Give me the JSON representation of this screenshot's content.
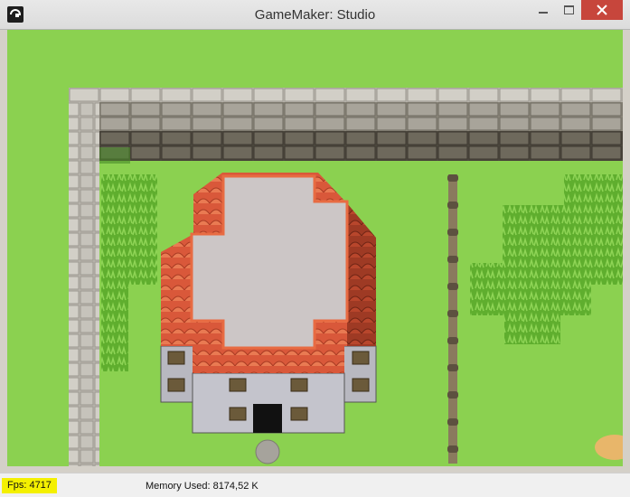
{
  "window": {
    "title": "GameMaker: Studio",
    "icon": "gamemaker-icon"
  },
  "controls": {
    "minimize": "minimize-icon",
    "maximize": "maximize-icon",
    "close": "close-icon"
  },
  "scene": {
    "description_icons": [
      "stone-wall",
      "house-red-roof",
      "hedge",
      "wooden-fence",
      "bush",
      "stepping-stone",
      "sand-patch"
    ]
  },
  "status": {
    "fps_label": "Fps: 4717",
    "memory_label": "Memory Used: 8174,52 K"
  },
  "colors": {
    "grass": "#8bd150",
    "roof": "#e0623a",
    "wall": "#a8a49a",
    "fps_highlight": "#f4f000",
    "close_button": "#c7463c"
  }
}
